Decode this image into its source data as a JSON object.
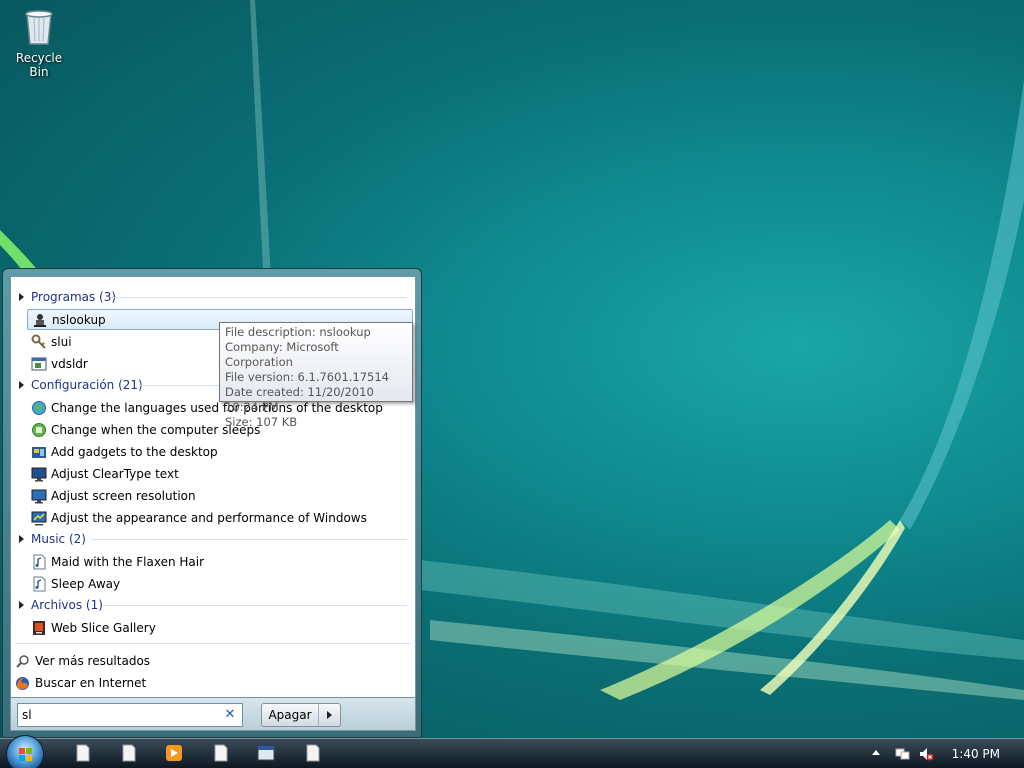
{
  "desktop": {
    "recycle_bin_label": "Recycle Bin"
  },
  "start_menu": {
    "groups": {
      "programs": "Programas (3)",
      "settings": "Configuración (21)",
      "music": "Music (2)",
      "files": "Archivos (1)"
    },
    "programs": [
      "nslookup",
      "slui",
      "vdsldr"
    ],
    "settings": [
      "Change the languages used for portions of the desktop",
      "Change when the computer sleeps",
      "Add gadgets to the desktop",
      "Adjust ClearType text",
      "Adjust screen resolution",
      "Adjust the appearance and performance of Windows"
    ],
    "music": [
      "Maid with the Flaxen Hair",
      "Sleep Away"
    ],
    "files": [
      "Web Slice Gallery"
    ],
    "more_results": "Ver más resultados",
    "search_internet": "Buscar en Internet",
    "search_value": "sl",
    "shutdown_label": "Apagar"
  },
  "tooltip": {
    "lines": [
      "File description: nslookup",
      "Company: Microsoft Corporation",
      "File version: 6.1.7601.17514",
      "Date created: 11/20/2010 10:24 PM",
      "Size: 107 KB"
    ]
  },
  "taskbar": {
    "clock": "1:40 PM"
  },
  "colors": {
    "group_header": "#1e3287",
    "selection_border": "#84acdd"
  }
}
